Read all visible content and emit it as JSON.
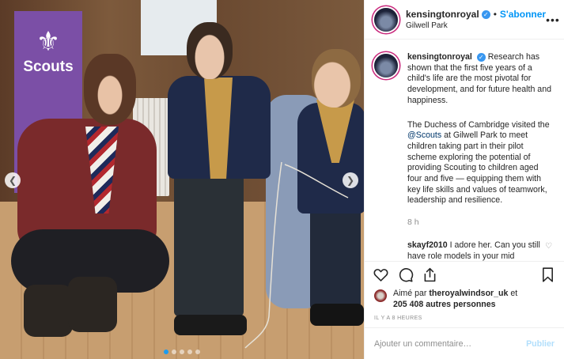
{
  "post": {
    "photo": {
      "banner_text": "Scouts",
      "carousel_dots": 5,
      "active_dot": 0
    },
    "header": {
      "username": "kensingtonroyal",
      "separator": "•",
      "follow_label": "S'abonner",
      "location": "Gilwell Park",
      "more_icon": "more-dots-icon"
    },
    "caption": {
      "username": "kensingtonroyal",
      "para1": "Research has shown that the first five years of a child's life are the most pivotal for development, and for future health and happiness.",
      "para2_before": "The Duchess of Cambridge visited the ",
      "para2_mention": "@Scouts",
      "para2_after": " at Gilwell Park to meet children taking part in their pilot scheme exploring the potential of providing Scouting to children aged four and five — equipping them with key life skills and values of teamwork, leadership and resilience.",
      "time": "8 h"
    },
    "comment": {
      "username": "skayf2010",
      "text": "I adore her. Can you still have role models in your mid"
    },
    "actions": {
      "like_icon": "heart-icon",
      "comment_icon": "comment-bubble-icon",
      "share_icon": "share-icon",
      "save_icon": "bookmark-icon"
    },
    "likes": {
      "prefix": "Aimé par ",
      "user": "theroyalwindsor_uk",
      "middle": " et ",
      "count": "205 408 autres personnes"
    },
    "posted_ago": "IL Y A 8 HEURES",
    "add_comment": {
      "placeholder": "Ajouter un commentaire…",
      "publish_label": "Publier"
    }
  },
  "colors": {
    "accent": "#0095f6",
    "verified": "#3897f0",
    "publish_disabled": "#b2dffc",
    "scouts_purple": "#7b4fa6"
  }
}
